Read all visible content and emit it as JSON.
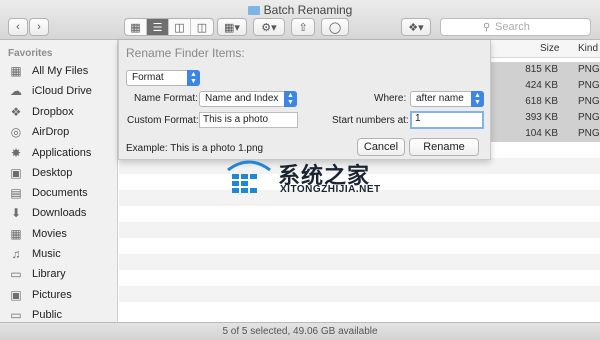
{
  "window": {
    "title": "Batch Renaming"
  },
  "search": {
    "placeholder": "Search"
  },
  "sidebar": {
    "heading": "Favorites",
    "items": [
      {
        "label": "All My Files",
        "icon": "all-files-icon"
      },
      {
        "label": "iCloud Drive",
        "icon": "cloud-icon"
      },
      {
        "label": "Dropbox",
        "icon": "dropbox-icon"
      },
      {
        "label": "AirDrop",
        "icon": "airdrop-icon"
      },
      {
        "label": "Applications",
        "icon": "applications-icon"
      },
      {
        "label": "Desktop",
        "icon": "desktop-icon"
      },
      {
        "label": "Documents",
        "icon": "documents-icon"
      },
      {
        "label": "Downloads",
        "icon": "downloads-icon"
      },
      {
        "label": "Movies",
        "icon": "movies-icon"
      },
      {
        "label": "Music",
        "icon": "music-icon"
      },
      {
        "label": "Library",
        "icon": "folder-icon"
      },
      {
        "label": "Pictures",
        "icon": "pictures-icon"
      },
      {
        "label": "Public",
        "icon": "folder-icon"
      }
    ]
  },
  "columns": {
    "size": "Size",
    "kind": "Kind"
  },
  "files": [
    {
      "size": "815 KB",
      "kind": "PNG"
    },
    {
      "size": "424 KB",
      "kind": "PNG"
    },
    {
      "size": "618 KB",
      "kind": "PNG"
    },
    {
      "size": "393 KB",
      "kind": "PNG"
    },
    {
      "size": "104 KB",
      "kind": "PNG"
    }
  ],
  "sheet": {
    "title": "Rename Finder Items:",
    "mode": "Format",
    "name_format_label": "Name Format:",
    "name_format_value": "Name and Index",
    "where_label": "Where:",
    "where_value": "after name",
    "custom_format_label": "Custom Format:",
    "custom_format_value": "This is a photo",
    "start_label": "Start numbers at:",
    "start_value": "1",
    "example": "Example: This is a photo 1.png",
    "cancel": "Cancel",
    "rename": "Rename"
  },
  "watermark": {
    "cn": "系统之家",
    "en": "XITONGZHIJIA.NET"
  },
  "status": {
    "text": "5 of 5 selected, 49.06 GB available"
  },
  "colors": {
    "accent": "#3d86e8",
    "selection": "#d0d0d0",
    "watermark_blue": "#1f86d8"
  }
}
